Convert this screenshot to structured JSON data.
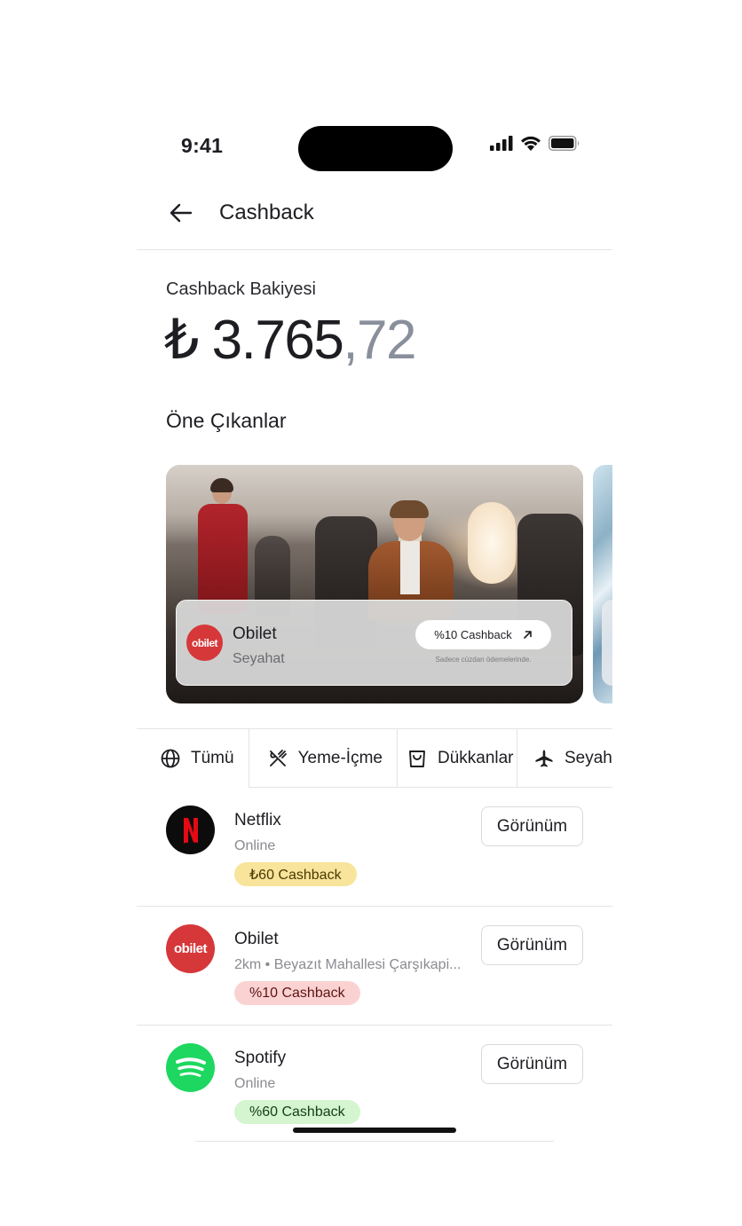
{
  "status_bar": {
    "time": "9:41"
  },
  "header": {
    "title": "Cashback"
  },
  "balance": {
    "label": "Cashback Bakiyesi",
    "integer": "₺ 3.765",
    "decimal": ",72"
  },
  "featured": {
    "title": "Öne Çıkanlar",
    "card": {
      "logo_text": "obilet",
      "name": "Obilet",
      "category": "Seyahat",
      "pill": "%10 Cashback",
      "note": "Sadece cüzdan ödemelerinde."
    }
  },
  "tabs": [
    {
      "label": "Tümü",
      "icon": "globe-icon"
    },
    {
      "label": "Yeme-İçme",
      "icon": "utensils-icon"
    },
    {
      "label": "Dükkanlar",
      "icon": "shopping-bag-icon"
    },
    {
      "label": "Seyahat",
      "icon": "airplane-icon"
    }
  ],
  "merchants": [
    {
      "name": "Netflix",
      "sub": "Online",
      "badge": "₺60 Cashback",
      "button": "Görünüm",
      "logo": "netflix-logo",
      "badge_bg": "#f8e49a",
      "badge_fg": "#4a3a05"
    },
    {
      "name": "Obilet",
      "sub": "2km • Beyazıt Mahallesi Çarşıkapi...",
      "badge": "%10 Cashback",
      "button": "Görünüm",
      "logo": "obilet-logo",
      "logo_text": "obilet",
      "badge_bg": "#fbd2d2",
      "badge_fg": "#5e1414"
    },
    {
      "name": "Spotify",
      "sub": "Online",
      "badge": "%60 Cashback",
      "button": "Görünüm",
      "logo": "spotify-logo",
      "badge_bg": "#d4f5cf",
      "badge_fg": "#16401a"
    }
  ],
  "colors": {
    "obilet_red": "#d6383a",
    "spotify_green": "#1ed760",
    "netflix_red": "#e50914"
  }
}
